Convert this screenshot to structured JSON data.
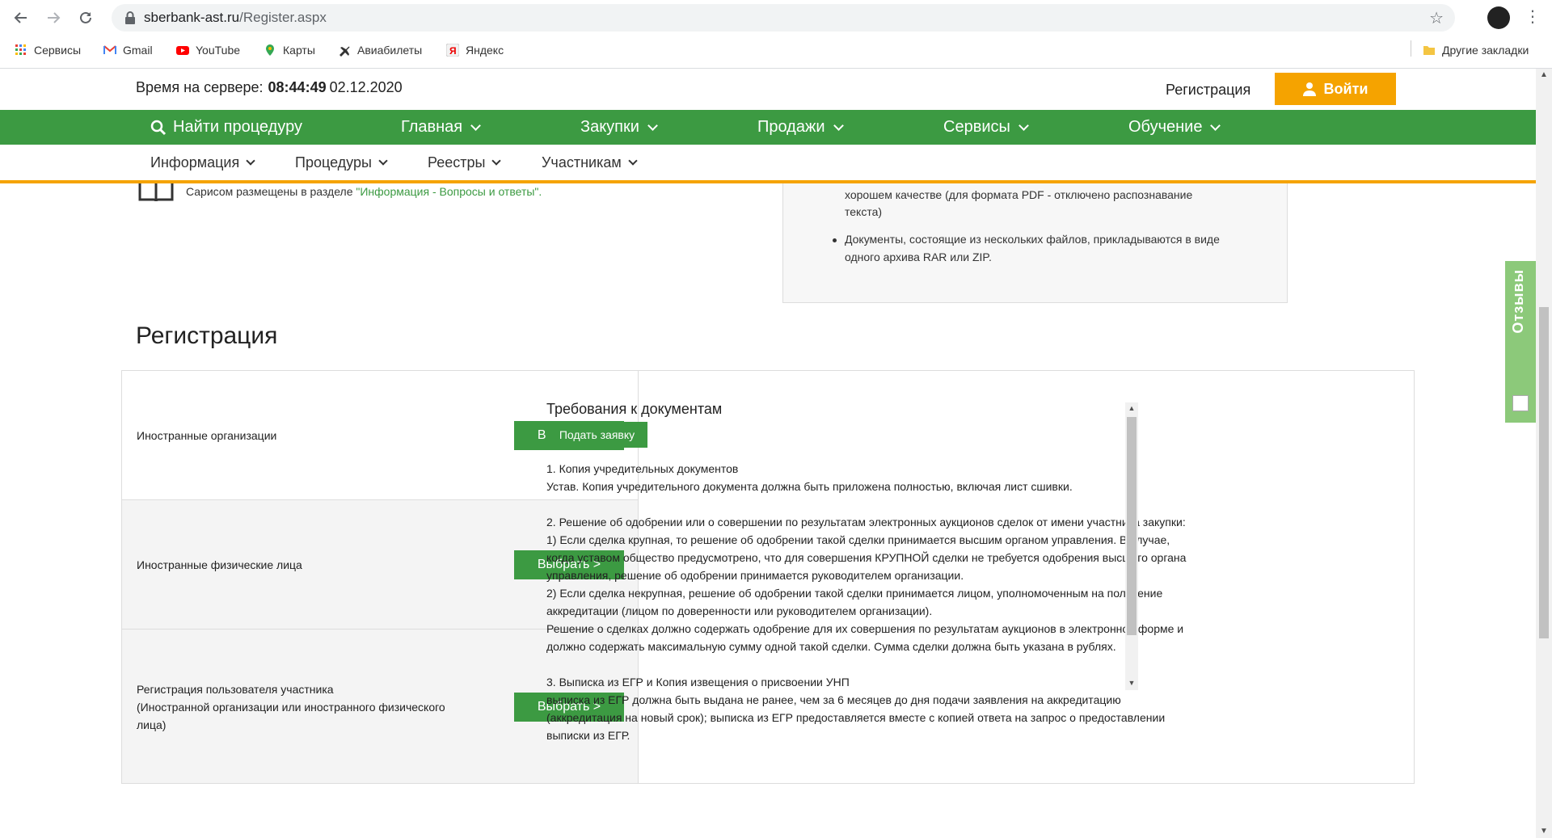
{
  "browser": {
    "url_host": "sberbank-ast.ru",
    "url_path": "/Register.aspx",
    "bookmarks": [
      {
        "label": "Сервисы",
        "icon": "apps-grid-icon"
      },
      {
        "label": "Gmail",
        "icon": "gmail-icon"
      },
      {
        "label": "YouTube",
        "icon": "youtube-icon"
      },
      {
        "label": "Карты",
        "icon": "maps-pin-icon"
      },
      {
        "label": "Авиабилеты",
        "icon": "plane-icon"
      },
      {
        "label": "Яндекс",
        "icon": "yandex-icon"
      }
    ],
    "other_bookmarks": "Другие закладки"
  },
  "topbar": {
    "server_time_label": "Время на сервере:",
    "server_time": "08:44:49",
    "server_date": "02.12.2020",
    "register_link": "Регистрация",
    "login_label": "Войти"
  },
  "main_nav": [
    "Найти процедуру",
    "Главная",
    "Закупки",
    "Продажи",
    "Сервисы",
    "Обучение"
  ],
  "sub_nav": [
    "Информация",
    "Процедуры",
    "Реестры",
    "Участникам"
  ],
  "fragments": {
    "left_text_a": "Сарисом размещены в разделе",
    "left_text_link": "\"Информация - Вопросы и ответы\".",
    "info_line1": "хорошем качестве (для формата PDF - отключено распознавание",
    "info_line2": "текста)",
    "info_bullet_line1": "Документы, состоящие из нескольких файлов, прикладываются в виде",
    "info_bullet_line2": "одного архива RAR или ZIP."
  },
  "registration": {
    "title": "Регистрация",
    "options": [
      {
        "label_lines": [
          "Иностранные организации"
        ],
        "button": "Выбрать >"
      },
      {
        "label_lines": [
          "Иностранные физические лица"
        ],
        "button": "Выбрать >"
      },
      {
        "label_lines": [
          "Регистрация пользователя участника",
          "(Иностранной организации или иностранного физического",
          "лица)"
        ],
        "button": "Выбрать >"
      }
    ],
    "requirements_title": "Требования к документам",
    "apply_button": "Подать заявку",
    "requirements_lines": [
      "1. Копия учредительных документов",
      "Устав. Копия учредительного документа должна быть приложена полностью, включая лист сшивки.",
      "",
      "2. Решение об одобрении или о совершении по результатам электронных аукционов сделок от имени участника закупки:",
      "1) Если сделка крупная, то решение об одобрении такой сделки принимается высшим органом управления. В случае,",
      "когда уставом общество предусмотрено, что для совершения КРУПНОЙ сделки не требуется одобрения высшего органа",
      "управления, решение об одобрении принимается руководителем организации.",
      "2) Если сделка некрупная, решение об одобрении такой сделки принимается лицом, уполномоченным на получение",
      "аккредитации (лицом по доверенности или руководителем организации).",
      "Решение о сделках должно содержать одобрение для их совершения по результатам аукционов в электронной форме и",
      "должно содержать максимальную сумму одной такой сделки. Сумма сделки должна быть указана в рублях.",
      "",
      "3. Выписка из ЕГР и Копия извещения о присвоении УНП",
      "выписка из ЕГР должна быть выдана не ранее, чем за 6 месяцев до дня подачи заявления на аккредитацию",
      "(аккредитация на новый срок); выписка из ЕГР предоставляется вместе с копией ответа на запрос о предоставлении",
      "выписки из ЕГР."
    ]
  },
  "feedback_tab": "Отзывы",
  "colors": {
    "green": "#3c9a42",
    "orange": "#f5a300",
    "feedback": "#8cc97a"
  }
}
